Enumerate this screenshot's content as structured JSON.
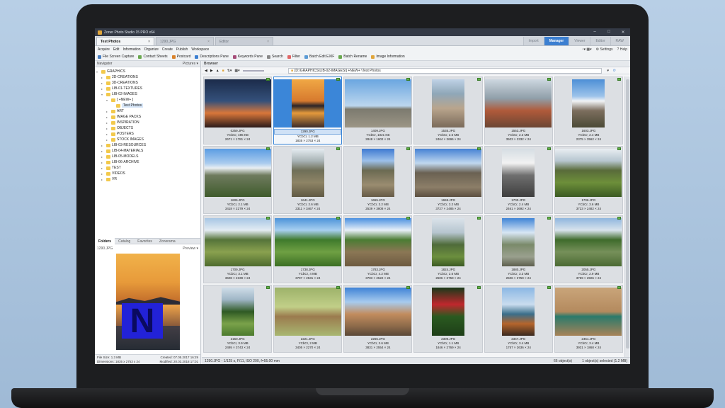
{
  "window": {
    "title": "Zoner Photo Studio 15 PRO x64",
    "doc_tabs": [
      {
        "label": "Test Photos",
        "active": true
      },
      {
        "label": "1290.JPG",
        "active": false
      },
      {
        "label": "Editor",
        "active": false
      }
    ],
    "mode_tabs": [
      {
        "label": "Import",
        "active": false
      },
      {
        "label": "Manager",
        "active": true
      },
      {
        "label": "Viewer",
        "active": false
      },
      {
        "label": "Editor",
        "active": false
      },
      {
        "label": "RAW",
        "active": false
      }
    ]
  },
  "menu": {
    "items": [
      "Acquire",
      "Edit",
      "Information",
      "Organize",
      "Create",
      "Publish",
      "Workspace"
    ],
    "settings_label": "Settings",
    "help_label": "Help"
  },
  "toolbar": {
    "items": [
      "File Screen Capture",
      "Contact Sheets",
      "Postcard",
      "Descriptions Pane",
      "Keywords Pane",
      "Search",
      "Filter",
      "Batch Edit EXIF",
      "Batch Rename",
      "Image Information"
    ]
  },
  "navigator": {
    "title": "Navigator",
    "mode": "Pictures",
    "tree": [
      {
        "label": "GRAPHICS",
        "depth": 0,
        "exp": "-"
      },
      {
        "label": "2D-CREATIONS",
        "depth": 1,
        "exp": "+"
      },
      {
        "label": "3D-CREATIONS",
        "depth": 1,
        "exp": "+"
      },
      {
        "label": "LIB-01-TEXTURES",
        "depth": 1,
        "exp": "+"
      },
      {
        "label": "LIB-02-IMAGES",
        "depth": 1,
        "exp": "-"
      },
      {
        "label": "[ +NEW+ ]",
        "depth": 2,
        "exp": "-"
      },
      {
        "label": "Test Photos",
        "depth": 3,
        "exp": "",
        "selected": true
      },
      {
        "label": "ART",
        "depth": 2,
        "exp": "+"
      },
      {
        "label": "IMAGE PACKS",
        "depth": 2,
        "exp": "+"
      },
      {
        "label": "INSPIRATION",
        "depth": 2,
        "exp": "+"
      },
      {
        "label": "OBJECTS",
        "depth": 2,
        "exp": "+"
      },
      {
        "label": "POSTERS",
        "depth": 2,
        "exp": "+"
      },
      {
        "label": "STOCK IMAGES",
        "depth": 2,
        "exp": "+"
      },
      {
        "label": "LIB-03-RESOURCES",
        "depth": 1,
        "exp": "+"
      },
      {
        "label": "LIB-04-MATERIALS",
        "depth": 1,
        "exp": "+"
      },
      {
        "label": "LIB-05-MODELS",
        "depth": 1,
        "exp": "+"
      },
      {
        "label": "LIB-06-ARCHIVE",
        "depth": 1,
        "exp": "+"
      },
      {
        "label": "TEST",
        "depth": 1,
        "exp": "+"
      },
      {
        "label": "VIDEOS",
        "depth": 1,
        "exp": "+"
      },
      {
        "label": "VR",
        "depth": 1,
        "exp": "+"
      }
    ]
  },
  "panel_tabs": [
    "Folders",
    "Catalog",
    "Favorites",
    "Zonerama"
  ],
  "preview": {
    "filename": "1290.JPG",
    "mode": "Preview",
    "file_size": "File Size: 1.3 MB",
    "created": "Created: 07.05.2017 16:29",
    "dimensions": "Dimensions: 1835 x 2753 x 24",
    "modified": "Modified: 20.03.2018 17:01"
  },
  "browser": {
    "title": "Browser",
    "path": "[D:\\GRAPHICS\\LIB-02-IMAGES\\] +NEW+ \\Test Photos"
  },
  "photos": [
    {
      "name": "0259.JPG",
      "info": "YCbCr, 485 KB",
      "dims": "2671 × 1781 × 24",
      "orient": "land",
      "scene": "wing",
      "selected": false
    },
    {
      "name": "1290.JPG",
      "info": "YCbCr, 1.2 MB",
      "dims": "1835 × 2753 × 24",
      "orient": "port",
      "scene": "sunset",
      "selected": true
    },
    {
      "name": "1409.JPG",
      "info": "YCbCr, 1021 KB",
      "dims": "2848 × 1602 × 24",
      "orient": "land",
      "scene": "plane",
      "selected": false
    },
    {
      "name": "1535.JPG",
      "info": "YCbCr, 2.6 MB",
      "dims": "2464 × 3696 × 24",
      "orient": "port",
      "scene": "street",
      "selected": false
    },
    {
      "name": "1553.JPG",
      "info": "YCbCr, 2.2 MB",
      "dims": "3503 × 2332 × 24",
      "orient": "land",
      "scene": "cafe",
      "selected": false
    },
    {
      "name": "1603.JPG",
      "info": "YCbCr, 2.4 MB",
      "dims": "2375 × 3562 × 24",
      "orient": "port",
      "scene": "peak",
      "selected": false
    },
    {
      "name": "1606.JPG",
      "info": "YCbCr, 2.1 MB",
      "dims": "3418 × 2279 × 24",
      "orient": "land",
      "scene": "mountain",
      "selected": false
    },
    {
      "name": "1641.JPG",
      "info": "YCbCr, 2.6 MB",
      "dims": "2311 × 3467 × 24",
      "orient": "port",
      "scene": "road",
      "selected": false
    },
    {
      "name": "1655.JPG",
      "info": "YCbCr, 3.2 MB",
      "dims": "2539 × 3808 × 24",
      "orient": "port",
      "scene": "trail",
      "selected": false
    },
    {
      "name": "1659.JPG",
      "info": "YCbCr, 3.2 MB",
      "dims": "3727 × 2485 × 24",
      "orient": "land",
      "scene": "rocky",
      "selected": false
    },
    {
      "name": "1700.JPG",
      "info": "YCbCr, 2.4 MB",
      "dims": "2461 × 3692 × 24",
      "orient": "port",
      "scene": "snowrock",
      "selected": false
    },
    {
      "name": "1706.JPG",
      "info": "YCbCr, 3.6 MB",
      "dims": "3723 × 2482 × 24",
      "orient": "land",
      "scene": "pasture",
      "selected": false
    },
    {
      "name": "1709.JPG",
      "info": "YCbCr, 3.1 MB",
      "dims": "3608 × 2339 × 24",
      "orient": "land",
      "scene": "valley",
      "selected": false
    },
    {
      "name": "1738.JPG",
      "info": "YCbCr, 4 MB",
      "dims": "3797 × 2531 × 24",
      "orient": "land",
      "scene": "hut",
      "selected": false
    },
    {
      "name": "1783.JPG",
      "info": "YCbCr, 4.2 MB",
      "dims": "3783 × 2522 × 24",
      "orient": "land",
      "scene": "village",
      "selected": false
    },
    {
      "name": "1824.JPG",
      "info": "YCbCr, 2.6 MB",
      "dims": "2506 × 3759 × 24",
      "orient": "port",
      "scene": "tree",
      "selected": false
    },
    {
      "name": "1880.JPG",
      "info": "YCbCr, 3.3 MB",
      "dims": "2506 × 3759 × 24",
      "orient": "port",
      "scene": "ruins",
      "selected": false
    },
    {
      "name": "2055.JPG",
      "info": "YCbCr, 2.9 MB",
      "dims": "3759 × 2506 × 24",
      "orient": "land",
      "scene": "machu",
      "selected": false
    },
    {
      "name": "2150.JPG",
      "info": "YCbCr, 3.9 MB",
      "dims": "2495 × 3743 × 24",
      "orient": "port",
      "scene": "bigtree",
      "selected": false
    },
    {
      "name": "2221.JPG",
      "info": "YCbCr, 2 MB",
      "dims": "3405 × 2270 × 24",
      "orient": "land",
      "scene": "llama",
      "selected": false
    },
    {
      "name": "2265.JPG",
      "info": "YCbCr, 2.6 MB",
      "dims": "3831 × 2554 × 24",
      "orient": "land",
      "scene": "church",
      "selected": false
    },
    {
      "name": "2309.JPG",
      "info": "YCbCr, 1.1 MB",
      "dims": "1846 × 2769 × 24",
      "orient": "port",
      "scene": "flowers",
      "selected": false
    },
    {
      "name": "2347.JPG",
      "info": "YCbCr, 3.4 MB",
      "dims": "1757 × 2636 × 24",
      "orient": "port",
      "scene": "boat",
      "selected": false
    },
    {
      "name": "2451.JPG",
      "info": "YCbCr, 3.4 MB",
      "dims": "3931 × 1868 × 24",
      "orient": "land",
      "scene": "butterfly",
      "selected": false
    }
  ],
  "status": {
    "selected_info": "1290.JPG - 1/125 s, F/11, ISO 200, f=55.00 mm",
    "count": "66 object(s)",
    "selection": "1 object(s) selected (1.2 MB)"
  },
  "colors": {
    "accent": "#3c7fd1",
    "selection": "#3b86d8",
    "flag": "#62b046"
  }
}
